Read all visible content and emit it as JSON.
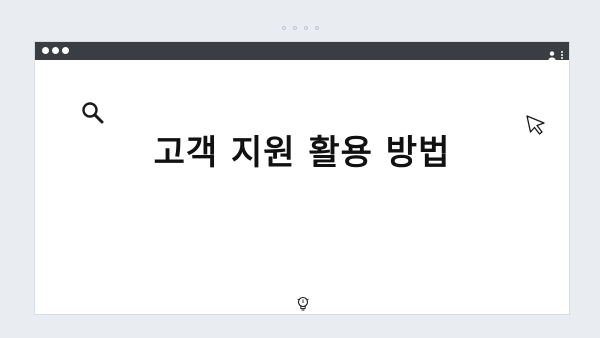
{
  "page": {
    "title": "고객 지원 활용 방법"
  },
  "titlebar": {
    "icons": [
      "user-icon",
      "kebab-menu-icon"
    ]
  },
  "decor": {
    "icons": [
      "search-icon",
      "cursor-icon",
      "lightbulb-icon"
    ]
  },
  "colors": {
    "background": "#e9ecf0",
    "titlebar": "#3a3d42",
    "window": "#ffffff",
    "text": "#111111"
  }
}
